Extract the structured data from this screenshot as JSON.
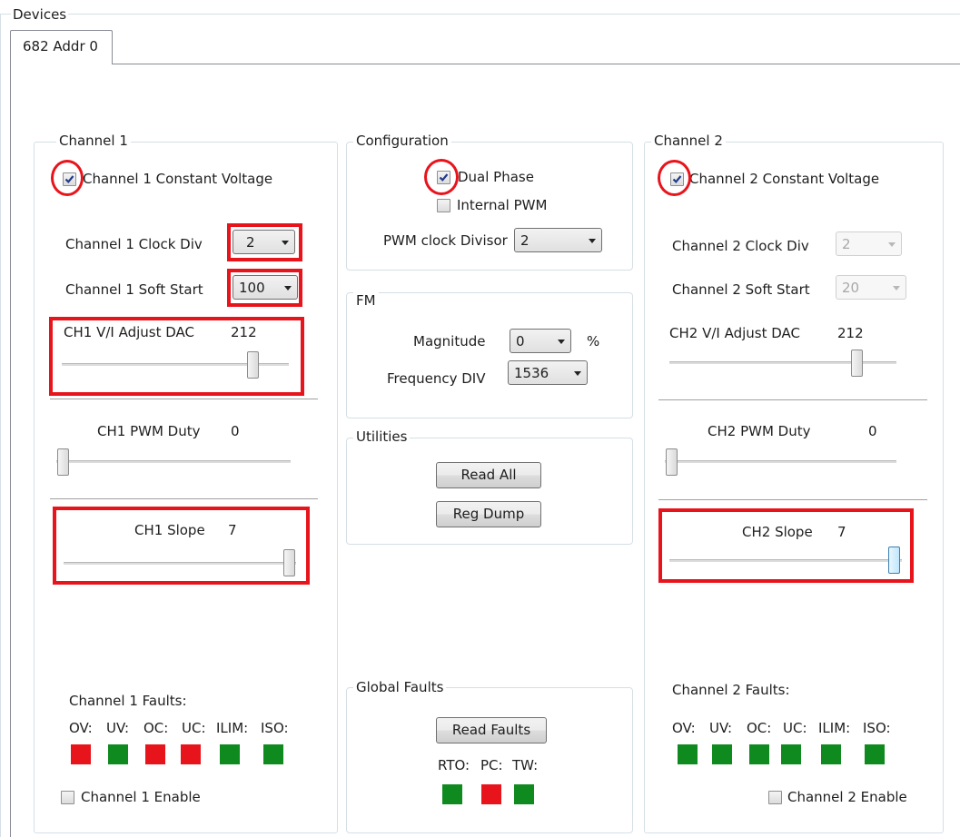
{
  "devices_label": "Devices",
  "tab_label": "682 Addr 0",
  "colors": {
    "fault_red": "#e8141c",
    "ok_green": "#0f8a1e",
    "annotation_red": "#e8141c"
  },
  "channel1": {
    "title": "Channel 1",
    "constant_voltage_label": "Channel 1 Constant Voltage",
    "constant_voltage_checked": true,
    "clock_div_label": "Channel 1 Clock Div",
    "clock_div_value": "2",
    "soft_start_label": "Channel 1 Soft Start",
    "soft_start_value": "100",
    "dac_label": "CH1 V/I Adjust DAC",
    "dac_value": "212",
    "pwm_label": "CH1 PWM Duty",
    "pwm_value": "0",
    "slope_label": "CH1 Slope",
    "slope_value": "7",
    "faults_label": "Channel 1 Faults:",
    "faults": [
      {
        "name": "OV:",
        "status": "red"
      },
      {
        "name": "UV:",
        "status": "green"
      },
      {
        "name": "OC:",
        "status": "red"
      },
      {
        "name": "UC:",
        "status": "red"
      },
      {
        "name": "ILIM:",
        "status": "green"
      },
      {
        "name": "ISO:",
        "status": "green"
      }
    ],
    "enable_label": "Channel 1 Enable",
    "enable_checked": false
  },
  "configuration": {
    "title": "Configuration",
    "dual_phase_label": "Dual Phase",
    "dual_phase_checked": true,
    "internal_pwm_label": "Internal PWM",
    "internal_pwm_checked": false,
    "pwm_divisor_label": "PWM clock Divisor",
    "pwm_divisor_value": "2"
  },
  "fm": {
    "title": "FM",
    "magnitude_label": "Magnitude",
    "magnitude_value": "0",
    "magnitude_unit": "%",
    "freq_div_label": "Frequency DIV",
    "freq_div_value": "1536"
  },
  "utilities": {
    "title": "Utilities",
    "read_all_label": "Read All",
    "reg_dump_label": "Reg Dump"
  },
  "global_faults": {
    "title": "Global Faults",
    "read_faults_label": "Read Faults",
    "faults": [
      {
        "name": "RTO:",
        "status": "green"
      },
      {
        "name": "PC:",
        "status": "red"
      },
      {
        "name": "TW:",
        "status": "green"
      }
    ]
  },
  "channel2": {
    "title": "Channel 2",
    "constant_voltage_label": "Channel 2 Constant Voltage",
    "constant_voltage_checked": true,
    "clock_div_label": "Channel 2 Clock Div",
    "clock_div_value": "2",
    "soft_start_label": "Channel 2 Soft Start",
    "soft_start_value": "20",
    "dac_label": "CH2 V/I Adjust DAC",
    "dac_value": "212",
    "pwm_label": "CH2 PWM Duty",
    "pwm_value": "0",
    "slope_label": "CH2 Slope",
    "slope_value": "7",
    "faults_label": "Channel 2 Faults:",
    "faults": [
      {
        "name": "OV:",
        "status": "green"
      },
      {
        "name": "UV:",
        "status": "green"
      },
      {
        "name": "OC:",
        "status": "green"
      },
      {
        "name": "UC:",
        "status": "green"
      },
      {
        "name": "ILIM:",
        "status": "green"
      },
      {
        "name": "ISO:",
        "status": "green"
      }
    ],
    "enable_label": "Channel 2 Enable",
    "enable_checked": false
  }
}
